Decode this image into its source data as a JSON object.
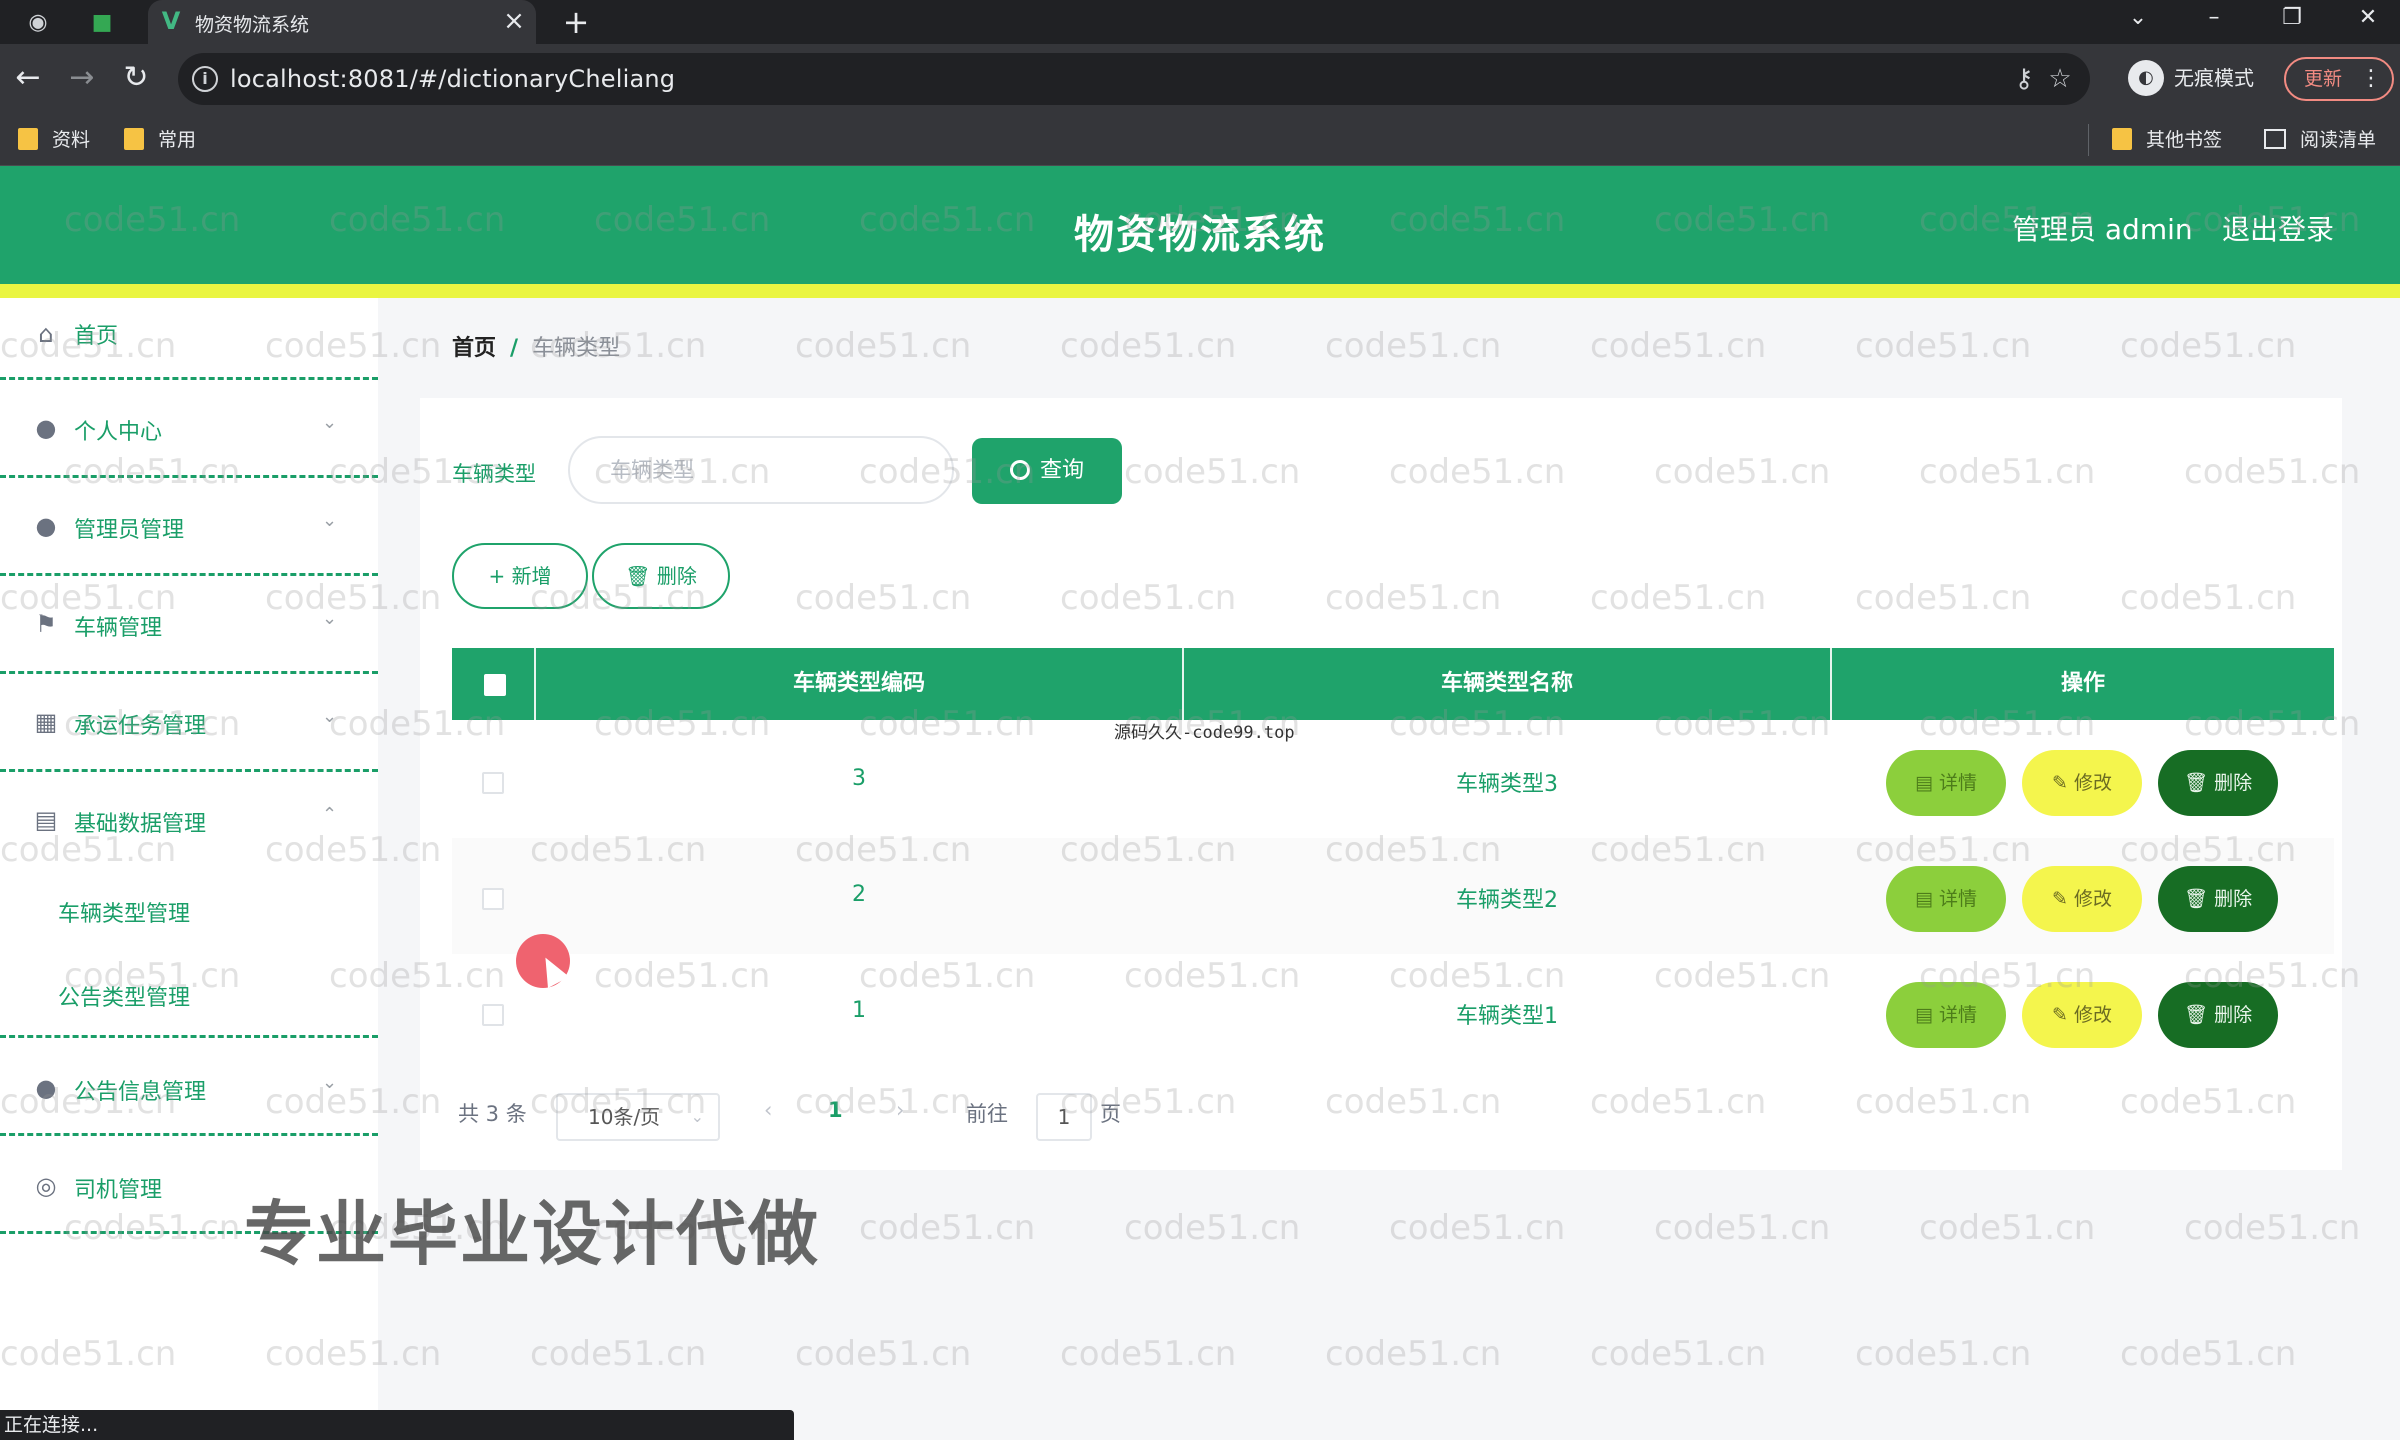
{
  "browser": {
    "tab_title": "物资物流系统",
    "tab_favicon": "V",
    "url": "localhost:8081/#/dictionaryCheliang",
    "incognito_label": "无痕模式",
    "update_label": "更新",
    "bookmarks": [
      "资料",
      "常用"
    ],
    "bookmarks_right": [
      "其他书签",
      "阅读清单"
    ],
    "status_text": "正在连接..."
  },
  "header": {
    "title": "物资物流系统",
    "admin_label": "管理员 admin",
    "logout_label": "退出登录"
  },
  "sidebar": {
    "items": [
      {
        "label": "首页",
        "icon": "home-icon"
      },
      {
        "label": "个人中心",
        "icon": "user-icon"
      },
      {
        "label": "管理员管理",
        "icon": "admin-icon"
      },
      {
        "label": "车辆管理",
        "icon": "flag-icon"
      },
      {
        "label": "承运任务管理",
        "icon": "task-icon"
      },
      {
        "label": "基础数据管理",
        "icon": "database-icon"
      },
      {
        "label": "公告信息管理",
        "icon": "location-icon"
      },
      {
        "label": "司机管理",
        "icon": "driver-icon"
      }
    ],
    "submenu": [
      "车辆类型管理",
      "公告类型管理"
    ]
  },
  "breadcrumb": {
    "home": "首页",
    "separator": "/",
    "current": "车辆类型"
  },
  "search": {
    "label": "车辆类型",
    "placeholder": "车辆类型",
    "button": "查询"
  },
  "actions": {
    "add": "新增",
    "delete": "删除"
  },
  "table": {
    "columns": [
      "车辆类型编码",
      "车辆类型名称",
      "操作"
    ],
    "rows": [
      {
        "code": "3",
        "name": "车辆类型3"
      },
      {
        "code": "2",
        "name": "车辆类型2"
      },
      {
        "code": "1",
        "name": "车辆类型1"
      }
    ],
    "row_actions": {
      "detail": "详情",
      "edit": "修改",
      "delete": "删除"
    }
  },
  "pagination": {
    "total": "共 3 条",
    "page_size": "10条/页",
    "current_page": "1",
    "goto_label": "前往",
    "goto_value": "1",
    "page_unit": "页"
  },
  "overlay": {
    "watermark": "code51.cn",
    "source_mark": "源码久久-code99.top",
    "promo_text": "专业毕业设计代做"
  },
  "colors": {
    "primary": "#1fa36b",
    "accent_bar": "#eaf542",
    "detail": "#8ccf3c",
    "edit": "#f4f54d",
    "delete": "#176d24"
  }
}
